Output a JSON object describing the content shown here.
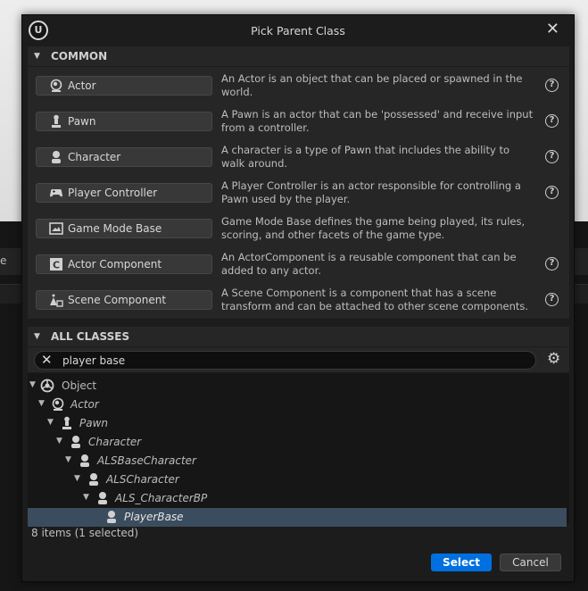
{
  "window": {
    "title": "Pick Parent Class",
    "logo_text": "U"
  },
  "background": {
    "left_fragment": "e"
  },
  "common": {
    "header": "COMMON",
    "items": [
      {
        "label": "Actor",
        "description": "An Actor is an object that can be placed or spawned in the world.",
        "icon": "actor-icon"
      },
      {
        "label": "Pawn",
        "description": "A Pawn is an actor that can be 'possessed' and receive input from a controller.",
        "icon": "pawn-icon"
      },
      {
        "label": "Character",
        "description": "A character is a type of Pawn that includes the ability to walk around.",
        "icon": "character-icon"
      },
      {
        "label": "Player Controller",
        "description": "A Player Controller is an actor responsible for controlling a Pawn used by the player.",
        "icon": "gamepad-icon"
      },
      {
        "label": "Game Mode Base",
        "description": "Game Mode Base defines the game being played, its rules, scoring, and other facets of the game type.",
        "icon": "game-mode-icon"
      },
      {
        "label": "Actor Component",
        "description": "An ActorComponent is a reusable component that can be added to any actor.",
        "icon": "actor-component-icon"
      },
      {
        "label": "Scene Component",
        "description": "A Scene Component is a component that has a scene transform and can be attached to other scene components.",
        "icon": "scene-component-icon"
      }
    ]
  },
  "all_classes": {
    "header": "ALL CLASSES",
    "search_value": "player base",
    "tree": [
      {
        "label": "Object",
        "icon": "object-icon",
        "selected": false
      },
      {
        "label": "Actor",
        "icon": "actor-icon",
        "selected": false
      },
      {
        "label": "Pawn",
        "icon": "pawn-icon",
        "selected": false
      },
      {
        "label": "Character",
        "icon": "character-icon",
        "selected": false
      },
      {
        "label": "ALSBaseCharacter",
        "icon": "character-icon",
        "selected": false
      },
      {
        "label": "ALSCharacter",
        "icon": "character-icon",
        "selected": false
      },
      {
        "label": "ALS_CharacterBP",
        "icon": "character-icon",
        "selected": false
      },
      {
        "label": "PlayerBase",
        "icon": "character-icon",
        "selected": true
      }
    ],
    "count_text": "8 items (1 selected)"
  },
  "footer": {
    "select_label": "Select",
    "cancel_label": "Cancel"
  },
  "colors": {
    "accent": "#0070e0",
    "selection": "#3b4c5e",
    "panel": "#262626",
    "dialog": "#1c1c1c"
  }
}
